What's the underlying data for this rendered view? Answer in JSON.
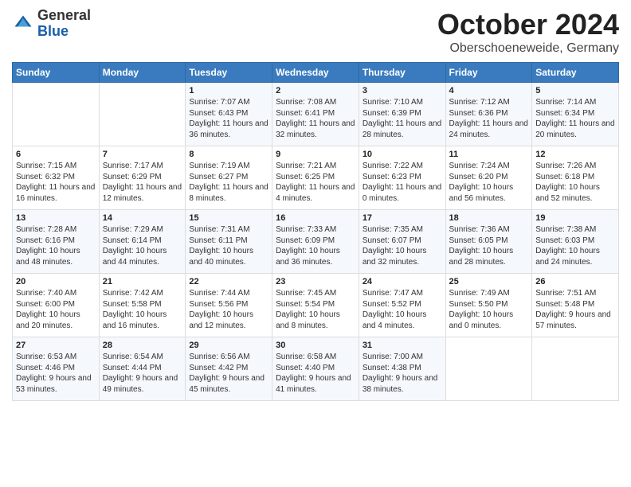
{
  "logo": {
    "general": "General",
    "blue": "Blue"
  },
  "title": "October 2024",
  "subtitle": "Oberschoeneweide, Germany",
  "days_of_week": [
    "Sunday",
    "Monday",
    "Tuesday",
    "Wednesday",
    "Thursday",
    "Friday",
    "Saturday"
  ],
  "weeks": [
    [
      {
        "day": "",
        "info": ""
      },
      {
        "day": "",
        "info": ""
      },
      {
        "day": "1",
        "info": "Sunrise: 7:07 AM\nSunset: 6:43 PM\nDaylight: 11 hours and 36 minutes."
      },
      {
        "day": "2",
        "info": "Sunrise: 7:08 AM\nSunset: 6:41 PM\nDaylight: 11 hours and 32 minutes."
      },
      {
        "day": "3",
        "info": "Sunrise: 7:10 AM\nSunset: 6:39 PM\nDaylight: 11 hours and 28 minutes."
      },
      {
        "day": "4",
        "info": "Sunrise: 7:12 AM\nSunset: 6:36 PM\nDaylight: 11 hours and 24 minutes."
      },
      {
        "day": "5",
        "info": "Sunrise: 7:14 AM\nSunset: 6:34 PM\nDaylight: 11 hours and 20 minutes."
      }
    ],
    [
      {
        "day": "6",
        "info": "Sunrise: 7:15 AM\nSunset: 6:32 PM\nDaylight: 11 hours and 16 minutes."
      },
      {
        "day": "7",
        "info": "Sunrise: 7:17 AM\nSunset: 6:29 PM\nDaylight: 11 hours and 12 minutes."
      },
      {
        "day": "8",
        "info": "Sunrise: 7:19 AM\nSunset: 6:27 PM\nDaylight: 11 hours and 8 minutes."
      },
      {
        "day": "9",
        "info": "Sunrise: 7:21 AM\nSunset: 6:25 PM\nDaylight: 11 hours and 4 minutes."
      },
      {
        "day": "10",
        "info": "Sunrise: 7:22 AM\nSunset: 6:23 PM\nDaylight: 11 hours and 0 minutes."
      },
      {
        "day": "11",
        "info": "Sunrise: 7:24 AM\nSunset: 6:20 PM\nDaylight: 10 hours and 56 minutes."
      },
      {
        "day": "12",
        "info": "Sunrise: 7:26 AM\nSunset: 6:18 PM\nDaylight: 10 hours and 52 minutes."
      }
    ],
    [
      {
        "day": "13",
        "info": "Sunrise: 7:28 AM\nSunset: 6:16 PM\nDaylight: 10 hours and 48 minutes."
      },
      {
        "day": "14",
        "info": "Sunrise: 7:29 AM\nSunset: 6:14 PM\nDaylight: 10 hours and 44 minutes."
      },
      {
        "day": "15",
        "info": "Sunrise: 7:31 AM\nSunset: 6:11 PM\nDaylight: 10 hours and 40 minutes."
      },
      {
        "day": "16",
        "info": "Sunrise: 7:33 AM\nSunset: 6:09 PM\nDaylight: 10 hours and 36 minutes."
      },
      {
        "day": "17",
        "info": "Sunrise: 7:35 AM\nSunset: 6:07 PM\nDaylight: 10 hours and 32 minutes."
      },
      {
        "day": "18",
        "info": "Sunrise: 7:36 AM\nSunset: 6:05 PM\nDaylight: 10 hours and 28 minutes."
      },
      {
        "day": "19",
        "info": "Sunrise: 7:38 AM\nSunset: 6:03 PM\nDaylight: 10 hours and 24 minutes."
      }
    ],
    [
      {
        "day": "20",
        "info": "Sunrise: 7:40 AM\nSunset: 6:00 PM\nDaylight: 10 hours and 20 minutes."
      },
      {
        "day": "21",
        "info": "Sunrise: 7:42 AM\nSunset: 5:58 PM\nDaylight: 10 hours and 16 minutes."
      },
      {
        "day": "22",
        "info": "Sunrise: 7:44 AM\nSunset: 5:56 PM\nDaylight: 10 hours and 12 minutes."
      },
      {
        "day": "23",
        "info": "Sunrise: 7:45 AM\nSunset: 5:54 PM\nDaylight: 10 hours and 8 minutes."
      },
      {
        "day": "24",
        "info": "Sunrise: 7:47 AM\nSunset: 5:52 PM\nDaylight: 10 hours and 4 minutes."
      },
      {
        "day": "25",
        "info": "Sunrise: 7:49 AM\nSunset: 5:50 PM\nDaylight: 10 hours and 0 minutes."
      },
      {
        "day": "26",
        "info": "Sunrise: 7:51 AM\nSunset: 5:48 PM\nDaylight: 9 hours and 57 minutes."
      }
    ],
    [
      {
        "day": "27",
        "info": "Sunrise: 6:53 AM\nSunset: 4:46 PM\nDaylight: 9 hours and 53 minutes."
      },
      {
        "day": "28",
        "info": "Sunrise: 6:54 AM\nSunset: 4:44 PM\nDaylight: 9 hours and 49 minutes."
      },
      {
        "day": "29",
        "info": "Sunrise: 6:56 AM\nSunset: 4:42 PM\nDaylight: 9 hours and 45 minutes."
      },
      {
        "day": "30",
        "info": "Sunrise: 6:58 AM\nSunset: 4:40 PM\nDaylight: 9 hours and 41 minutes."
      },
      {
        "day": "31",
        "info": "Sunrise: 7:00 AM\nSunset: 4:38 PM\nDaylight: 9 hours and 38 minutes."
      },
      {
        "day": "",
        "info": ""
      },
      {
        "day": "",
        "info": ""
      }
    ]
  ]
}
